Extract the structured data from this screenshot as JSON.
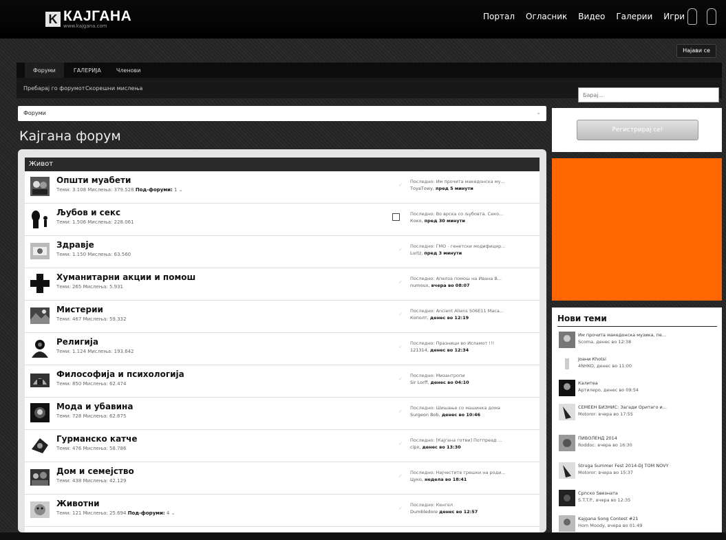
{
  "header": {
    "logo_mark": "K",
    "logo_text": "КАЈГАНА",
    "logo_sub": "www.kajgana.com",
    "nav": [
      "Портал",
      "Огласник",
      "Видео",
      "Галерии",
      "Игри"
    ],
    "join_label": "Најави се"
  },
  "tabs": [
    "Форуми",
    "ГАЛЕРИЈА",
    "Членови"
  ],
  "subnav": [
    "Пребарај го форумот",
    "Скорешни мислења"
  ],
  "search": {
    "placeholder": "Барај..."
  },
  "breadcrumb": "Форуми",
  "page_title": "Кајгана форум",
  "section": "Живот",
  "forums": [
    {
      "name": "Општи муабети",
      "stats": "Теми: 3.108 Мислења: 379.528",
      "sub_label": "Под-форуми:",
      "sub_count": "1",
      "last": "Последно: Им прочита македонска му...",
      "last_user": "ТоуаТоwу,",
      "last_time": "пред 5 минути"
    },
    {
      "name": "Љубов и секс",
      "stats": "Теми: 1.506 Мислења: 228.061",
      "last": "Последно: Во врска со љубовта. Секо...",
      "last_user": "Коко,",
      "last_time": "пред 30 минути"
    },
    {
      "name": "Здравје",
      "stats": "Теми: 1.150 Мислења: 63.560",
      "last": "Последно: ГМО - генетски модифицир...",
      "last_user": "Lurtz,",
      "last_time": "пред 3 минути"
    },
    {
      "name": "Хуманитарни акции и помош",
      "stats": "Теми: 265 Мислења: 5.931",
      "last": "Последно: Апелза помош на Ивана В...",
      "last_user": "numoux,",
      "last_time": "вчера во 08:07"
    },
    {
      "name": "Мистерии",
      "stats": "Теми: 467 Мислења: 59.332",
      "last": "Последно: Ancient Aliens S06E11 Maca...",
      "last_user": "Кополт,",
      "last_time": "денес во 12:19"
    },
    {
      "name": "Религија",
      "stats": "Теми: 1.124 Мислења: 193.642",
      "last": "Последно: Празници во Исламот !!!",
      "last_user": "121314,",
      "last_time": "денес во 12:34"
    },
    {
      "name": "Философија и психологија",
      "stats": "Теми: 850 Мислења: 62.474",
      "last": "Последно: Мизантропи",
      "last_user": "Sir Lorff,",
      "last_time": "денес во 04:10"
    },
    {
      "name": "Мода и убавина",
      "stats": "Теми: 728 Мислења: 62.675",
      "last": "Последно: Шишање со машинка дома",
      "last_user": "Surgeon Bob,",
      "last_time": "денес во 10:46"
    },
    {
      "name": "Гурманско катче",
      "stats": "Теми: 476 Мислења: 58.786",
      "last": "Последно: [Кајгана готви] Потпреад ...",
      "last_user": "сiрх,",
      "last_time": "денес во 13:30"
    },
    {
      "name": "Дом и семејство",
      "stats": "Теми: 438 Мислења: 42.129",
      "last": "Последно: Најчестите грешки на роди...",
      "last_user": "Цуко,",
      "last_time": "недела во 18:41"
    },
    {
      "name": "Животни",
      "stats": "Теми: 121 Мислења: 25.694",
      "sub_label": "Под-форуми:",
      "sub_count": "4",
      "last": "Последно: Кенгел",
      "last_user": "Dumbledore",
      "last_time": "денес во 12:57"
    }
  ],
  "sidebar": {
    "register_label": "Регистрирај се!",
    "ad_color": "#ff6600",
    "new_topics_title": "Нови теми",
    "new_topics": [
      {
        "title": "Им прочита македонска музика, пе...",
        "meta": "Scoma, денес во 12:38"
      },
      {
        "title": "Јоани Кhotsi",
        "meta": "4NHKO, денес во 11:00"
      },
      {
        "title": "Калитеа",
        "meta": "Артилеро, денес во 09:54"
      },
      {
        "title": "СЕМЕЕН БИЗНИС: Загади Оритаго и...",
        "meta": "Мotoror: вчера во 17:55"
      },
      {
        "title": "ПИВОЛЕНД 2014",
        "meta": "Roddoc: вчера во 16:30"
      },
      {
        "title": "Struga Summer Fest 2014-DJ TOM NOVY",
        "meta": "Мotoror: вчера во 15:37"
      },
      {
        "title": "Српско Ѕвезната",
        "meta": "S.T.T.P., вчера во 12:35"
      },
      {
        "title": "Kajgana Song Contest #21",
        "meta": "Hom Moody, вчера во 01:49"
      }
    ]
  }
}
